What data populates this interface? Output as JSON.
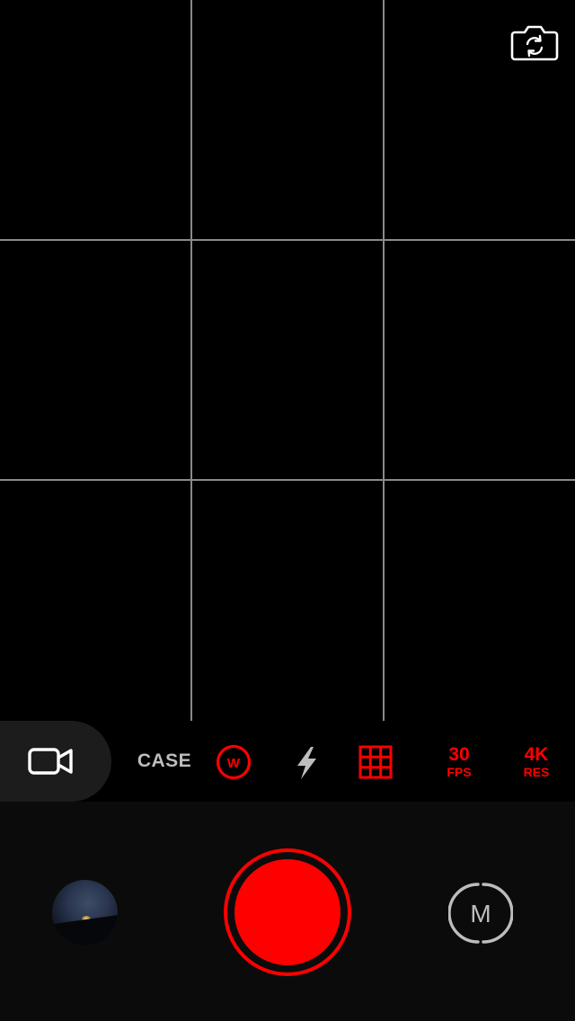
{
  "viewfinder": {
    "grid_enabled": true,
    "flip_camera_icon": "camera-flip-icon"
  },
  "toolbar": {
    "mode_icon": "video-camera-icon",
    "case_label": "CASE",
    "lens_icon": "wide-lens-icon",
    "lens_letter": "W",
    "flash_icon": "flash-icon",
    "grid_icon": "grid-icon",
    "fps_value": "30",
    "fps_unit": "FPS",
    "res_value": "4K",
    "res_unit": "RES"
  },
  "controls": {
    "gallery_thumbnail": "gallery-thumbnail",
    "record_icon": "record-button",
    "manual_label": "M"
  },
  "colors": {
    "accent": "#ff0000",
    "grid_line": "#8a8a8a",
    "inactive_icon": "#bdbdbd",
    "pill_bg": "#1c1c1c",
    "panel_bg": "#0b0b0b"
  }
}
